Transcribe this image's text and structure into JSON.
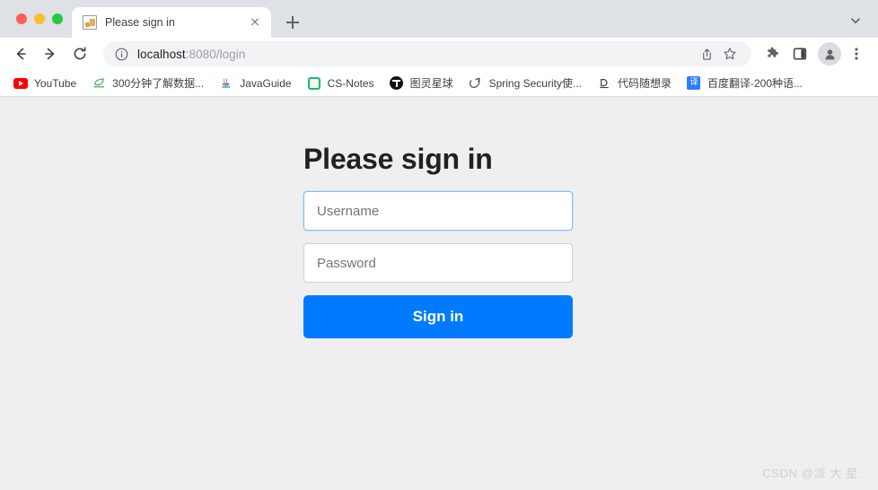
{
  "browser": {
    "window_controls": [
      "close",
      "minimize",
      "maximize"
    ],
    "tab": {
      "title": "Please sign in",
      "favicon": "broken-image-icon",
      "close_label": "×"
    },
    "new_tab_label": "+",
    "tab_search_icon": "chevron-down-icon",
    "toolbar": {
      "back_icon": "arrow-left-icon",
      "forward_icon": "arrow-right-icon",
      "reload_icon": "reload-icon",
      "site_info_icon": "info-circle-icon",
      "url_host": "localhost",
      "url_path": ":8080/login",
      "url_full": "localhost:8080/login",
      "share_icon": "share-icon",
      "bookmark_icon": "star-icon",
      "extensions_icon": "puzzle-icon",
      "side_panel_icon": "side-panel-icon",
      "profile_icon": "person-avatar-icon",
      "menu_icon": "three-dot-menu-icon"
    },
    "bookmarks": [
      {
        "label": "YouTube",
        "icon": "youtube-icon"
      },
      {
        "label": "300分钟了解数据...",
        "icon": "leaf-icon"
      },
      {
        "label": "JavaGuide",
        "icon": "java-cup-icon"
      },
      {
        "label": "CS-Notes",
        "icon": "notes-icon"
      },
      {
        "label": "图灵星球",
        "icon": "turing-icon"
      },
      {
        "label": "Spring Security使...",
        "icon": "spring-leaf-icon"
      },
      {
        "label": "代码随想录",
        "icon": "d-code-icon"
      },
      {
        "label": "百度翻译-200种语...",
        "icon": "baidu-translate-icon"
      }
    ]
  },
  "page": {
    "title": "Please sign in",
    "username": {
      "value": "",
      "placeholder": "Username",
      "focused": true
    },
    "password": {
      "value": "",
      "placeholder": "Password",
      "focused": false
    },
    "submit_label": "Sign in",
    "watermark": "CSDN @派 大 星.",
    "colors": {
      "background": "#efefef",
      "accent": "#007bff",
      "focus_border": "#80bdff",
      "heading": "#212121",
      "placeholder": "#757575"
    }
  }
}
